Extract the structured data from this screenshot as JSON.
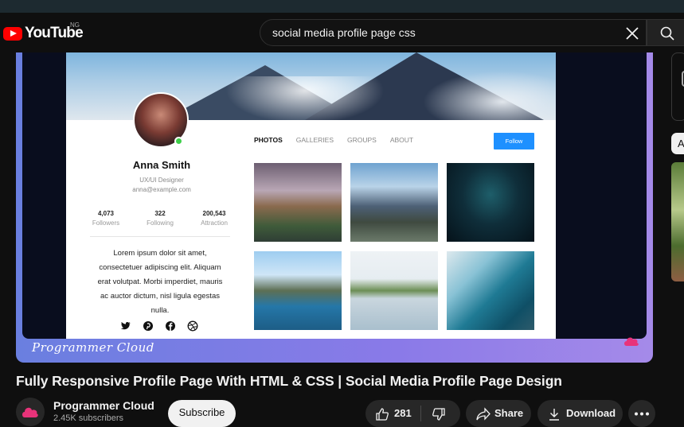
{
  "masthead": {
    "logo_text": "YouTube",
    "country_code": "NG",
    "search_value": "social media profile page css"
  },
  "player": {
    "channel_watermark": "Programmer Cloud",
    "profile": {
      "name": "Anna Smith",
      "role": "UX/UI Designer",
      "email": "anna@example.com",
      "stats": [
        {
          "value": "4,073",
          "label": "Followers"
        },
        {
          "value": "322",
          "label": "Following"
        },
        {
          "value": "200,543",
          "label": "Attraction"
        }
      ],
      "bio_lines": [
        "Lorem ipsum dolor sit amet,",
        "consectetuer adipiscing elit. Aliquam",
        "erat volutpat. Morbi imperdiet, mauris",
        "ac auctor dictum, nisl ligula egestas",
        "nulla."
      ],
      "tabs": [
        "PHOTOS",
        "GALLERIES",
        "GROUPS",
        "ABOUT"
      ],
      "follow_label": "Follow",
      "social_icons": [
        "twitter-icon",
        "pinterest-icon",
        "facebook-icon",
        "dribbble-icon"
      ]
    }
  },
  "video": {
    "title": "Fully Responsive Profile Page With HTML & CSS | Social Media Profile Page Design",
    "channel_name": "Programmer Cloud",
    "channel_subs": "2.45K subscribers",
    "subscribe_label": "Subscribe",
    "like_count": "281",
    "share_label": "Share",
    "download_label": "Download"
  },
  "sidebar": {
    "chip_label": "A"
  },
  "colors": {
    "accent": "#ff0000",
    "follow_blue": "#1e90ff",
    "online_green": "#3ecf4a"
  }
}
